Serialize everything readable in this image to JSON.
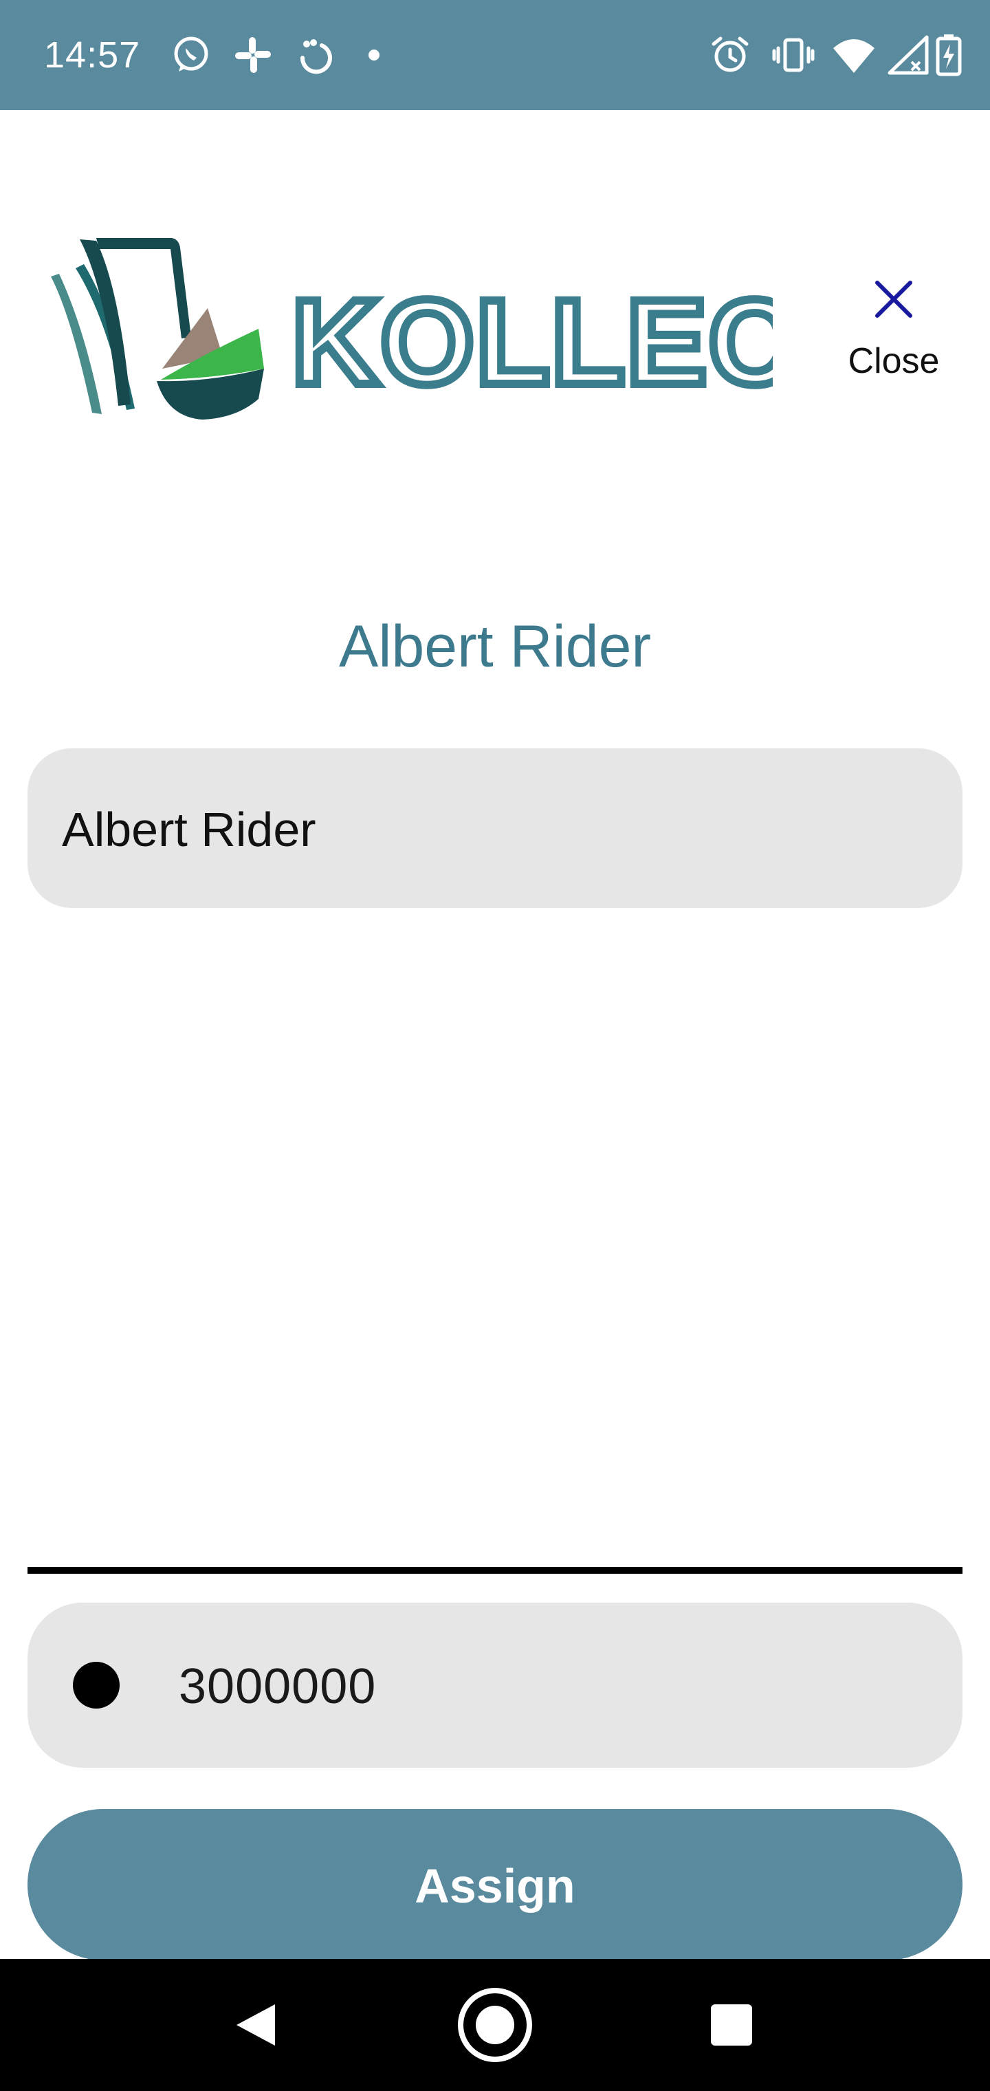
{
  "status_bar": {
    "time": "14:57",
    "background_color": "#5a8a9e",
    "left_icons": [
      "whatsapp-icon",
      "slack-icon",
      "sync-icon",
      "more-dot-icon"
    ],
    "right_icons": [
      "alarm-icon",
      "vibrate-icon",
      "wifi-icon",
      "signal-icon",
      "battery-charging-icon"
    ]
  },
  "header": {
    "logo_text": "KOLLECT IT",
    "close_label": "Close",
    "close_icon": "close-icon"
  },
  "main": {
    "title": "Albert Rider",
    "name_field_value": "Albert Rider",
    "amount_value": "3000000",
    "assign_label": "Assign"
  },
  "nav_bar": {
    "icons": [
      "back-icon",
      "home-icon",
      "recents-icon"
    ]
  },
  "colors": {
    "accent": "#5a8a9e",
    "title": "#3d7a8e",
    "field_bg": "#e6e6e6",
    "logo_teal": "#3a7d8c",
    "logo_dark": "#174a4f",
    "logo_green": "#3cb54a",
    "close_x": "#1a1aa0"
  }
}
